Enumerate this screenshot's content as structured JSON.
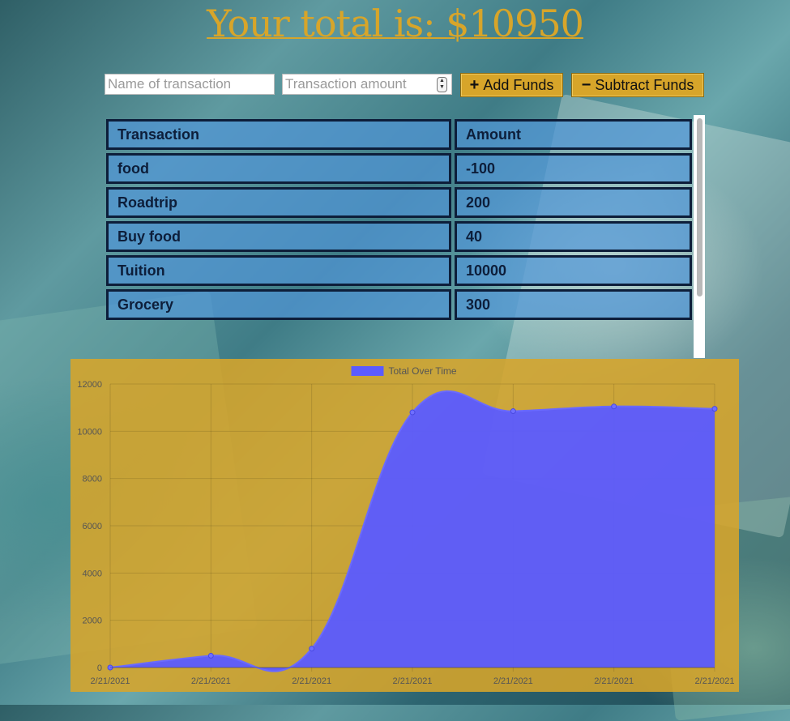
{
  "header": {
    "total_label": "Your total is: $10950"
  },
  "form": {
    "name_placeholder": "Name of transaction",
    "amount_placeholder": "Transaction amount",
    "add_icon": "plus-icon",
    "add_label": "Add Funds",
    "subtract_icon": "minus-icon",
    "subtract_label": "Subtract Funds"
  },
  "table": {
    "headers": [
      "Transaction",
      "Amount"
    ],
    "rows": [
      [
        "food",
        "-100"
      ],
      [
        "Roadtrip",
        "200"
      ],
      [
        "Buy food",
        "40"
      ],
      [
        "Tuition",
        "10000"
      ],
      [
        "Grocery",
        "300"
      ]
    ]
  },
  "colors": {
    "accent": "#d7a52a",
    "series": "#5b5bff",
    "cell_border": "#0d1e3a"
  },
  "chart_data": {
    "type": "area",
    "legend": "Total Over Time",
    "legend_position": "top",
    "categories": [
      "2/21/2021",
      "2/21/2021",
      "2/21/2021",
      "2/21/2021",
      "2/21/2021",
      "2/21/2021",
      "2/21/2021"
    ],
    "series": [
      {
        "name": "Total Over Time",
        "values": [
          0,
          500,
          800,
          10800,
          10850,
          11050,
          10950
        ]
      }
    ],
    "ylim": [
      0,
      12000
    ],
    "yticks": [
      0,
      2000,
      4000,
      6000,
      8000,
      10000,
      12000
    ],
    "grid": true
  }
}
